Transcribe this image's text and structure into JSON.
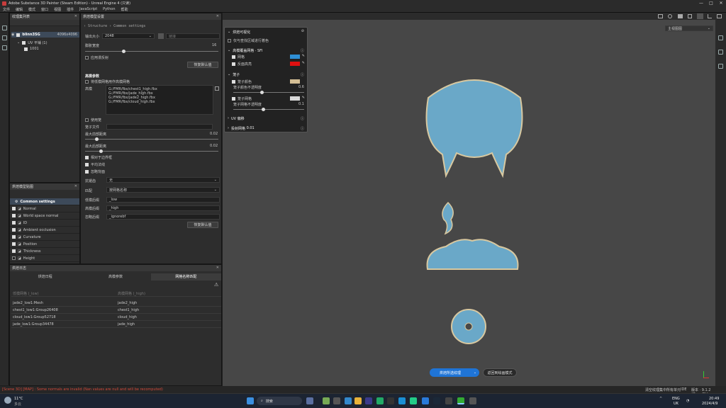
{
  "window": {
    "title": "Adobe Substance 3D Painter (Steam Edition) - Unreal Engine 4 (只读)",
    "min": "—",
    "max": "□",
    "close": "✕"
  },
  "menu": [
    "文件",
    "编辑",
    "模式",
    "窗口",
    "视图",
    "插件",
    "JavaScript",
    "Python",
    "帮助"
  ],
  "texture_set_list": {
    "title": "纹理集列表",
    "item_name": "blinn3SG",
    "item_res": "4096x4096",
    "uv_tile": "UV 平铺 (1)",
    "uv_id": "1001"
  },
  "baking": {
    "title": "烘焙模型设置",
    "breadcrumb_1": "Structure",
    "breadcrumb_2": "Common settings",
    "output_size_label": "输出大小",
    "output_size_value": "2048",
    "linked": "链接",
    "dilation_label": "膨胀宽度",
    "dilation_value": "16",
    "apply_diffusion": "应用漫反射",
    "reset_btn": "恢复默认值",
    "high_def_title": "高模参数",
    "use_low_as_high": "将低模网格用作高模网格",
    "high_meshes_label": "高模",
    "high_meshes": [
      "G:/FMR/fbx/chest1_high.fbx",
      "G:/FMR/fbx/jade_high.fbx",
      "G:/FMR/fbx/jade2_high.fbx",
      "G:/FMR/fbx/cloud_high.fbx"
    ],
    "cage_label": "使用笼",
    "cage_file_label": "笼子文件",
    "max_frontal_label": "最大前部距离",
    "max_frontal_value": "0.02",
    "max_rear_label": "最大后部距离",
    "max_rear_value": "0.02",
    "relative_bbox": "相对于边界框",
    "average_normals": "平均法线",
    "ignore_backface": "忽略背面",
    "antialias_label": "抗锯齿",
    "antialias_value": "无",
    "match_label": "匹配",
    "match_value": "按网格名称",
    "low_suffix_label": "低模后缀",
    "low_suffix_value": "_low",
    "high_suffix_label": "高模后缀",
    "high_suffix_value": "_high",
    "ignore_suffix_label": "忽略后缀",
    "ignore_suffix_value": "_ignorebf",
    "reset_btn2": "恢复默认值"
  },
  "maps": {
    "title": "烘焙模型贴图",
    "items": [
      {
        "label": "Common settings",
        "on": true
      },
      {
        "label": "Normal",
        "on": true
      },
      {
        "label": "World space normal",
        "on": true
      },
      {
        "label": "ID",
        "on": true
      },
      {
        "label": "Ambient occlusion",
        "on": true
      },
      {
        "label": "Curvature",
        "on": true
      },
      {
        "label": "Position",
        "on": true
      },
      {
        "label": "Thickness",
        "on": true
      },
      {
        "label": "Height",
        "on": false
      }
    ]
  },
  "log": {
    "title": "烘焙日志",
    "tabs": [
      "烘焙日程",
      "高模参数",
      "网格名称匹配"
    ],
    "col1": "低模网格 (_low)",
    "col2": "高模网格 (_high)",
    "rows": [
      [
        "jade2_low1:Mesh",
        "jade2_high"
      ],
      [
        "chest1_low1:Group26408",
        "chest1_high"
      ],
      [
        "cloud_low1:Group52718",
        "cloud_high"
      ],
      [
        "jade_low1:Group34478",
        "jade_high"
      ]
    ]
  },
  "overlay": {
    "title": "烘焙可视化",
    "show_only": "仅与查找区域进行着色",
    "section_cage": "高模覆盖网格 · SFI",
    "wire": "网格",
    "wire_color": "#2e8fd6",
    "backface": "反面高亮",
    "backface_color": "#e01010",
    "section_color": "笼子",
    "cage_color_label": "笼子颜色",
    "cage_color": "#d4be94",
    "cage_opacity_label": "笼子颜色不透明度",
    "cage_opacity": "0.6",
    "mesh_label": "笼子网格",
    "mesh_color": "#d8d8d8",
    "mesh_opacity_label": "笼子网格不透明度",
    "mesh_opacity": "0.1",
    "section_uv": "UV 偏移",
    "section_proj": "投射网格",
    "proj_value": "0.01"
  },
  "viewport": {
    "dropdown": "主视图图",
    "bake_btn": "烘焙所选纹理",
    "exit_btn": "返回到绘画模式"
  },
  "status": {
    "error": "[Scene 3D] [MAP] : Some normals are invalid (Nan values are null and will be recomputed)",
    "info_left": "清空纹理集中所有单元",
    "info_mid": "IDE",
    "info_ver": "版本 · 9.1.2 (OpenGL)"
  },
  "taskbar": {
    "weather_temp": "11°C",
    "weather_desc": "多云",
    "search": "搜索",
    "lang1": "ENG",
    "lang2": "UK",
    "time": "20:49",
    "date": "2024/4/9"
  }
}
